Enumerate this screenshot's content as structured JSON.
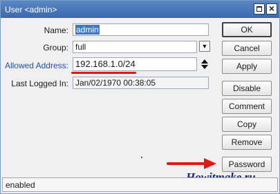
{
  "window": {
    "title": "User <admin>",
    "maximize_icon": "maximize-icon",
    "close_icon": "close-icon",
    "close_glyph": "×"
  },
  "form": {
    "name_label": "Name:",
    "name_value": "admin",
    "group_label": "Group:",
    "group_value": "full",
    "group_dropdown_glyph": "▼",
    "allowed_address_label": "Allowed Address:",
    "allowed_address_value": "192.168.1.0/24",
    "last_logged_in_label": "Last Logged In:",
    "last_logged_in_value": "Jan/02/1970 00:38:05"
  },
  "buttons": {
    "ok": "OK",
    "cancel": "Cancel",
    "apply": "Apply",
    "disable": "Disable",
    "comment": "Comment",
    "copy": "Copy",
    "remove": "Remove",
    "password": "Password"
  },
  "watermark": "Howitmake.ru",
  "status": {
    "text": "enabled"
  },
  "colors": {
    "title_bar": "#3a6aae",
    "accent_label": "#1f4fa8",
    "annotation_red": "#e01818",
    "selection": "#3a79c9",
    "watermark": "#17297a"
  }
}
